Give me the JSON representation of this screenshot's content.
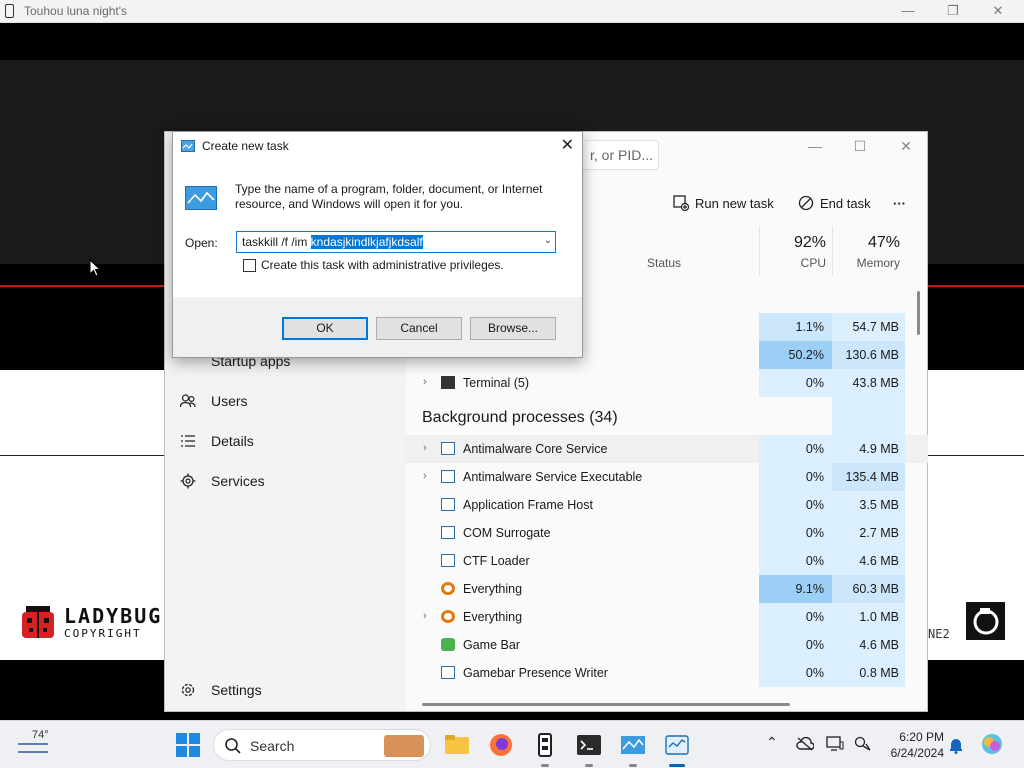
{
  "game_window": {
    "title": "Touhou luna night's",
    "controls": [
      "—",
      "❐",
      "✕"
    ],
    "logo_left": {
      "name": "LADYBUG",
      "sub": "COPYRIGHT"
    },
    "logo_right_text": "NE2"
  },
  "task_manager": {
    "search_placeholder": "r, or PID...",
    "window_controls": [
      "—",
      "☐",
      "✕"
    ],
    "toolbar": {
      "run_new_task": "Run new task",
      "end_task": "End task",
      "more": "···"
    },
    "columns": {
      "status": "Status",
      "cpu": {
        "pct": "92%",
        "label": "CPU"
      },
      "memory": {
        "pct": "47%",
        "label": "Memory"
      }
    },
    "nav": [
      {
        "label": "Startup apps",
        "icon": "startup-icon"
      },
      {
        "label": "Users",
        "icon": "users-icon"
      },
      {
        "label": "Details",
        "icon": "details-icon"
      },
      {
        "label": "Services",
        "icon": "services-icon"
      },
      {
        "label": "Settings",
        "icon": "settings-icon"
      }
    ],
    "apps": [
      {
        "name": "",
        "cpu": "1.1%",
        "mem": "54.7 MB"
      },
      {
        "name": "",
        "cpu": "50.2%",
        "mem": "130.6 MB"
      },
      {
        "name": "Terminal (5)",
        "cpu": "0%",
        "mem": "43.8 MB"
      }
    ],
    "background_header": "Background processes (34)",
    "background": [
      {
        "name": "Antimalware Core Service",
        "cpu": "0%",
        "mem": "4.9 MB",
        "expand": true,
        "icon": "window"
      },
      {
        "name": "Antimalware Service Executable",
        "cpu": "0%",
        "mem": "135.4 MB",
        "expand": true,
        "icon": "window"
      },
      {
        "name": "Application Frame Host",
        "cpu": "0%",
        "mem": "3.5 MB",
        "expand": false,
        "icon": "window"
      },
      {
        "name": "COM Surrogate",
        "cpu": "0%",
        "mem": "2.7 MB",
        "expand": false,
        "icon": "window"
      },
      {
        "name": "CTF Loader",
        "cpu": "0%",
        "mem": "4.6 MB",
        "expand": false,
        "icon": "window"
      },
      {
        "name": "Everything",
        "cpu": "9.1%",
        "mem": "60.3 MB",
        "expand": false,
        "icon": "everything"
      },
      {
        "name": "Everything",
        "cpu": "0%",
        "mem": "1.0 MB",
        "expand": true,
        "icon": "everything"
      },
      {
        "name": "Game Bar",
        "cpu": "0%",
        "mem": "4.6 MB",
        "expand": false,
        "icon": "gamebar"
      },
      {
        "name": "Gamebar Presence Writer",
        "cpu": "0%",
        "mem": "0.8 MB",
        "expand": false,
        "icon": "window"
      }
    ]
  },
  "run_dialog": {
    "title": "Create new task",
    "close": "✕",
    "description": "Type the name of a program, folder, document, or Internet resource, and Windows will open it for you.",
    "open_label": "Open:",
    "command_prefix": "taskkill /f /im ",
    "command_selected": "kndasjkindlkjafjkdsalf",
    "admin_checkbox": "Create this task with administrative privileges.",
    "buttons": {
      "ok": "OK",
      "cancel": "Cancel",
      "browse": "Browse..."
    }
  },
  "taskbar": {
    "weather_temp": "74°",
    "search_label": "Search",
    "tray_chevron": "⌃",
    "time": "6:20 PM",
    "date": "6/24/2024"
  },
  "colors": {
    "accent": "#0078d7",
    "cpu_low": "#dcefff",
    "cpu_mid": "#cce6fb",
    "cpu_high": "#9ccff5",
    "game_red": "#c21a1a"
  }
}
